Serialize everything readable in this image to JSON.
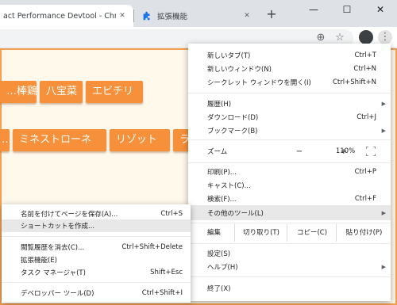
{
  "tabs": [
    {
      "title": "act Performance Devtool - Chr",
      "close": "✕"
    },
    {
      "title": "拡張機能",
      "close": "✕"
    }
  ],
  "newtab": "+",
  "window": {
    "minimize": "—",
    "maximize": "☐",
    "close": "✕"
  },
  "toolbar": {
    "zoom_icon": "⊕",
    "star_icon": "☆",
    "menu_icon": "⋮"
  },
  "page": {
    "row1": [
      "…棒鶏",
      "八宝菜",
      "エビチリ"
    ],
    "row2": [
      "…",
      "ミネストローネ",
      "リゾット",
      "ラ"
    ]
  },
  "menu": {
    "items_top": [
      {
        "label": "新しいタブ(T)",
        "shortcut": "Ctrl+T"
      },
      {
        "label": "新しいウィンドウ(N)",
        "shortcut": "Ctrl+N"
      },
      {
        "label": "シークレット ウィンドウを開く(I)",
        "shortcut": "Ctrl+Shift+N"
      }
    ],
    "items_hist": [
      {
        "label": "履歴(H)",
        "shortcut": "",
        "arrow": "▶"
      },
      {
        "label": "ダウンロード(D)",
        "shortcut": "Ctrl+J"
      },
      {
        "label": "ブックマーク(B)",
        "shortcut": "",
        "arrow": "▶"
      }
    ],
    "zoom": {
      "label": "ズーム",
      "minus": "−",
      "value": "110%",
      "plus": "+"
    },
    "items_print": [
      {
        "label": "印刷(P)...",
        "shortcut": "Ctrl+P"
      },
      {
        "label": "キャスト(C)...",
        "shortcut": ""
      },
      {
        "label": "検索(F)...",
        "shortcut": "Ctrl+F"
      },
      {
        "label": "その他のツール(L)",
        "shortcut": "",
        "arrow": "▶"
      }
    ],
    "edit": {
      "label": "編集",
      "cut": "切り取り(T)",
      "copy": "コピー(C)",
      "paste": "貼り付け(P)"
    },
    "items_settings": [
      {
        "label": "設定(S)",
        "shortcut": ""
      },
      {
        "label": "ヘルプ(H)",
        "shortcut": "",
        "arrow": "▶"
      }
    ],
    "exit": {
      "label": "終了(X)"
    }
  },
  "submenu": {
    "items_save": [
      {
        "label": "名前を付けてページを保存(A)...",
        "shortcut": "Ctrl+S"
      },
      {
        "label": "ショートカットを作成...",
        "shortcut": ""
      }
    ],
    "items_tools": [
      {
        "label": "閲覧履歴を消去(C)...",
        "shortcut": "Ctrl+Shift+Delete"
      },
      {
        "label": "拡張機能(E)",
        "shortcut": ""
      },
      {
        "label": "タスク マネージャ(T)",
        "shortcut": "Shift+Esc"
      }
    ],
    "devtools": {
      "label": "デベロッパー ツール(D)",
      "shortcut": "Ctrl+Shift+I"
    }
  }
}
